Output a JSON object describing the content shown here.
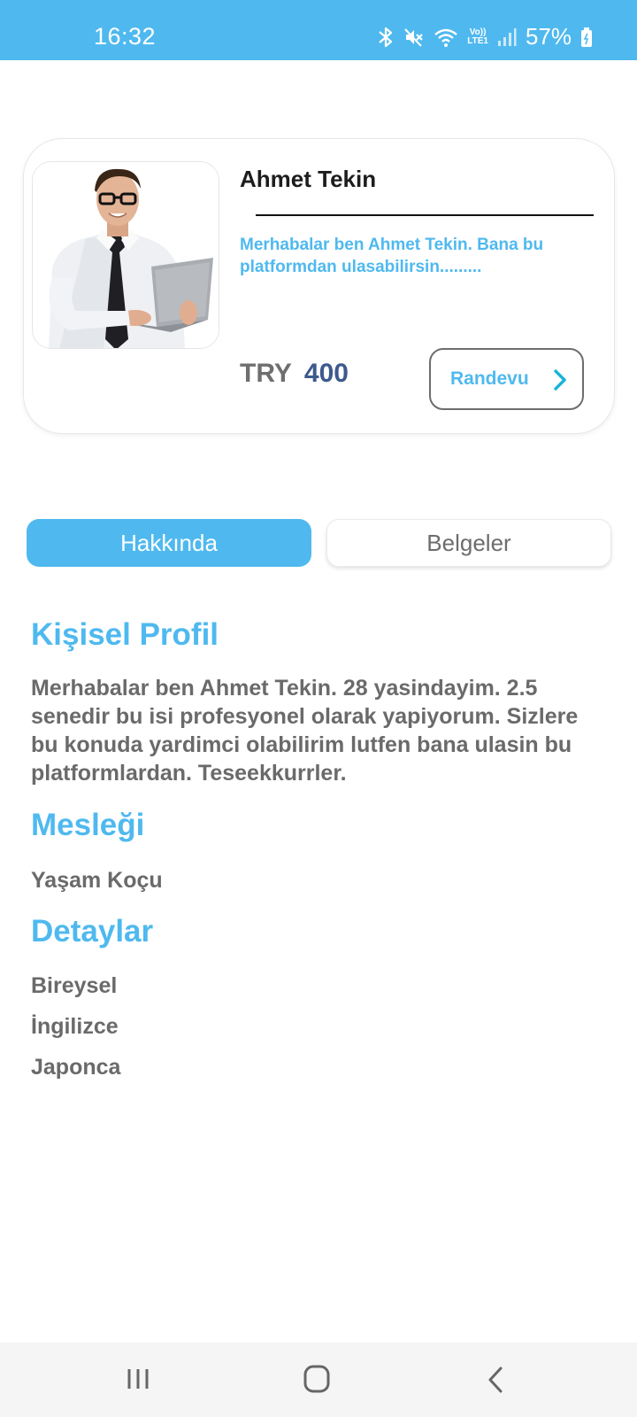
{
  "status_bar": {
    "time": "16:32",
    "battery": "57%",
    "icons": [
      "bluetooth-icon",
      "mute-icon",
      "wifi-icon",
      "volte-icon",
      "signal-icon",
      "battery-icon"
    ],
    "lte_label_top": "Vo))",
    "lte_label_bottom": "LTE1"
  },
  "profile_card": {
    "name": "Ahmet Tekin",
    "bio": "Merhabalar ben Ahmet Tekin. Bana bu platformdan ulasabilirsin.........",
    "price_currency": "TRY",
    "price_value": "400",
    "book_button_label": "Randevu"
  },
  "tabs": [
    {
      "label": "Hakkında",
      "active": true
    },
    {
      "label": "Belgeler",
      "active": false
    }
  ],
  "sections": {
    "profile_title": "Kişisel Profil",
    "profile_text": "Merhabalar ben Ahmet Tekin. 28 yasindayim. 2.5 senedir bu isi profesyonel olarak yapiyorum. Sizlere bu konuda yardimci olabilirim lutfen bana ulasin bu platformlardan. Teseekkurrler.",
    "occupation_title": "Mesleği",
    "occupation_value": "Yaşam Koçu",
    "details_title": "Detaylar",
    "details": [
      "Bireysel",
      "İngilizce",
      "Japonca"
    ]
  },
  "colors": {
    "accent": "#4fb9ef",
    "price": "#3d5a8c",
    "text_gray": "#6a6a6a",
    "chevron": "#17b3d8"
  }
}
